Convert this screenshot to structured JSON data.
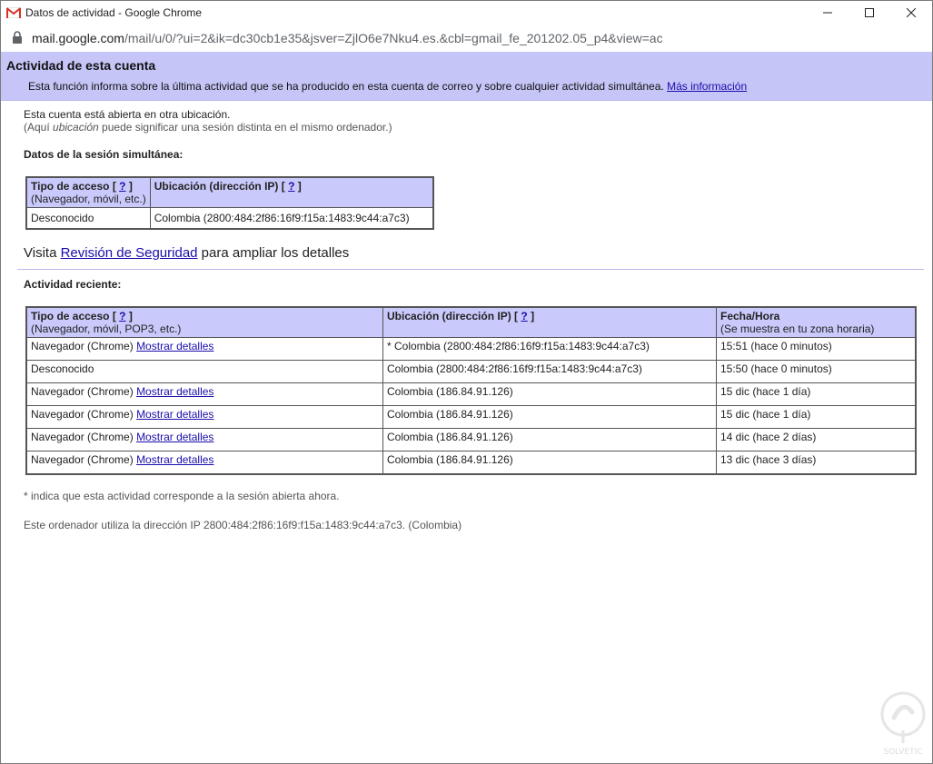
{
  "window": {
    "title": "Datos de actividad - Google Chrome"
  },
  "url": {
    "host": "mail.google.com",
    "path": "/mail/u/0/?ui=2&ik=dc30cb1e35&jsver=ZjlO6e7Nku4.es.&cbl=gmail_fe_201202.05_p4&view=ac"
  },
  "banner": {
    "title": "Actividad de esta cuenta",
    "description": "Esta función informa sobre la última actividad que se ha producido en esta cuenta de correo y sobre cualquier actividad simultánea.",
    "more_link": "Más información"
  },
  "session": {
    "open_elsewhere": "Esta cuenta está abierta en otra ubicación.",
    "note_prefix": "(Aquí ",
    "note_italic": "ubicación",
    "note_suffix": " puede significar una sesión distinta en el mismo ordenador.)",
    "section_title": "Datos de la sesión simultánea:",
    "table": {
      "col1_title": "Tipo de acceso",
      "col1_sub": "(Navegador, móvil, etc.)",
      "col2_title": "Ubicación (dirección IP)",
      "help_link": "?",
      "row": {
        "type": "Desconocido",
        "location": "Colombia (2800:484:2f86:16f9:f15a:1483:9c44:a7c3)"
      }
    }
  },
  "visit": {
    "prefix": "Visita ",
    "link": "Revisión de Seguridad",
    "suffix": " para ampliar los detalles"
  },
  "recent": {
    "section_title": "Actividad reciente:",
    "col1_title": "Tipo de acceso",
    "col1_sub": "(Navegador, móvil, POP3, etc.)",
    "col2_title": "Ubicación (dirección IP)",
    "col3_title": "Fecha/Hora",
    "col3_sub": "(Se muestra en tu zona horaria)",
    "help_link": "?",
    "details_link": "Mostrar detalles",
    "rows": [
      {
        "type": "Navegador (Chrome)",
        "details": true,
        "location": "* Colombia (2800:484:2f86:16f9:f15a:1483:9c44:a7c3)",
        "time": "15:51 (hace 0 minutos)"
      },
      {
        "type": "Desconocido",
        "details": false,
        "location": "Colombia (2800:484:2f86:16f9:f15a:1483:9c44:a7c3)",
        "time": "15:50 (hace 0 minutos)"
      },
      {
        "type": "Navegador (Chrome)",
        "details": true,
        "location": "Colombia (186.84.91.126)",
        "time": "15 dic (hace 1 día)"
      },
      {
        "type": "Navegador (Chrome)",
        "details": true,
        "location": "Colombia (186.84.91.126)",
        "time": "15 dic (hace 1 día)"
      },
      {
        "type": "Navegador (Chrome)",
        "details": true,
        "location": "Colombia (186.84.91.126)",
        "time": "14 dic (hace 2 días)"
      },
      {
        "type": "Navegador (Chrome)",
        "details": true,
        "location": "Colombia (186.84.91.126)",
        "time": "13 dic (hace 3 días)"
      }
    ]
  },
  "footer": {
    "asterisk_note": "* indica que esta actividad corresponde a la sesión abierta ahora.",
    "ip_note": "Este ordenador utiliza la dirección IP 2800:484:2f86:16f9:f15a:1483:9c44:a7c3. (Colombia)"
  },
  "colors": {
    "header_bg": "#c5c5f7",
    "table_header_bg": "#c9c9fb",
    "link": "#1a0dab"
  }
}
